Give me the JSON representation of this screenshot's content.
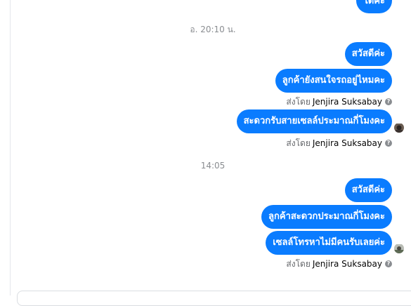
{
  "conversation": {
    "top_message": "ได้ค่ะ",
    "timestamp_1": "อ. 20:10 น.",
    "group_1": [
      "สวัสดีค่ะ",
      "ลูกค้ายังสนใจรถอยู่ไหมคะ"
    ],
    "sent_by_prefix": "ส่งโดย",
    "sender_name": "Jenjira Suksabay",
    "group_1b": [
      "สะดวกรับสายเซลล์ประมาณกี่โมงคะ"
    ],
    "timestamp_2": "14:05",
    "group_2": [
      "สวัสดีค่ะ",
      "ลูกค้าสะดวกประมาณกี่โมงคะ",
      "เซลล์โทรหาไม่มีคนรับเลยค่ะ"
    ],
    "info_icon_glyph": "?"
  },
  "colors": {
    "bubble": "#0a7cff",
    "meta_text": "#65676b"
  },
  "icons": {
    "seen_avatar_1": "seen-avatar-icon",
    "seen_avatar_2": "seen-avatar-icon",
    "info": "question-icon"
  }
}
